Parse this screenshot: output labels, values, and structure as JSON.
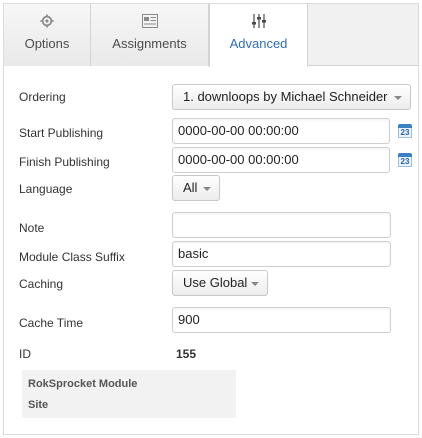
{
  "tabs": [
    {
      "label": "Options",
      "icon": "gear-icon",
      "active": false
    },
    {
      "label": "Assignments",
      "icon": "module-icon",
      "active": false
    },
    {
      "label": "Advanced",
      "icon": "sliders-icon",
      "active": true
    }
  ],
  "colors": {
    "active_tab_text": "#2f6eb5",
    "calendar_accent": "#3b7fc4"
  },
  "form": {
    "ordering": {
      "label": "Ordering",
      "value": "1. downloops by Michael Schneider"
    },
    "start_publishing": {
      "label": "Start Publishing",
      "value": "0000-00-00 00:00:00",
      "calendar_day": "23"
    },
    "finish_publishing": {
      "label": "Finish Publishing",
      "value": "0000-00-00 00:00:00",
      "calendar_day": "23"
    },
    "language": {
      "label": "Language",
      "value": "All"
    },
    "note": {
      "label": "Note",
      "value": ""
    },
    "module_class_suffix": {
      "label": "Module Class Suffix",
      "value": "basic"
    },
    "caching": {
      "label": "Caching",
      "value": "Use Global"
    },
    "cache_time": {
      "label": "Cache Time",
      "value": "900"
    },
    "id": {
      "label": "ID",
      "value": "155"
    }
  },
  "info": {
    "line1": "RokSprocket Module",
    "line2": "Site"
  }
}
